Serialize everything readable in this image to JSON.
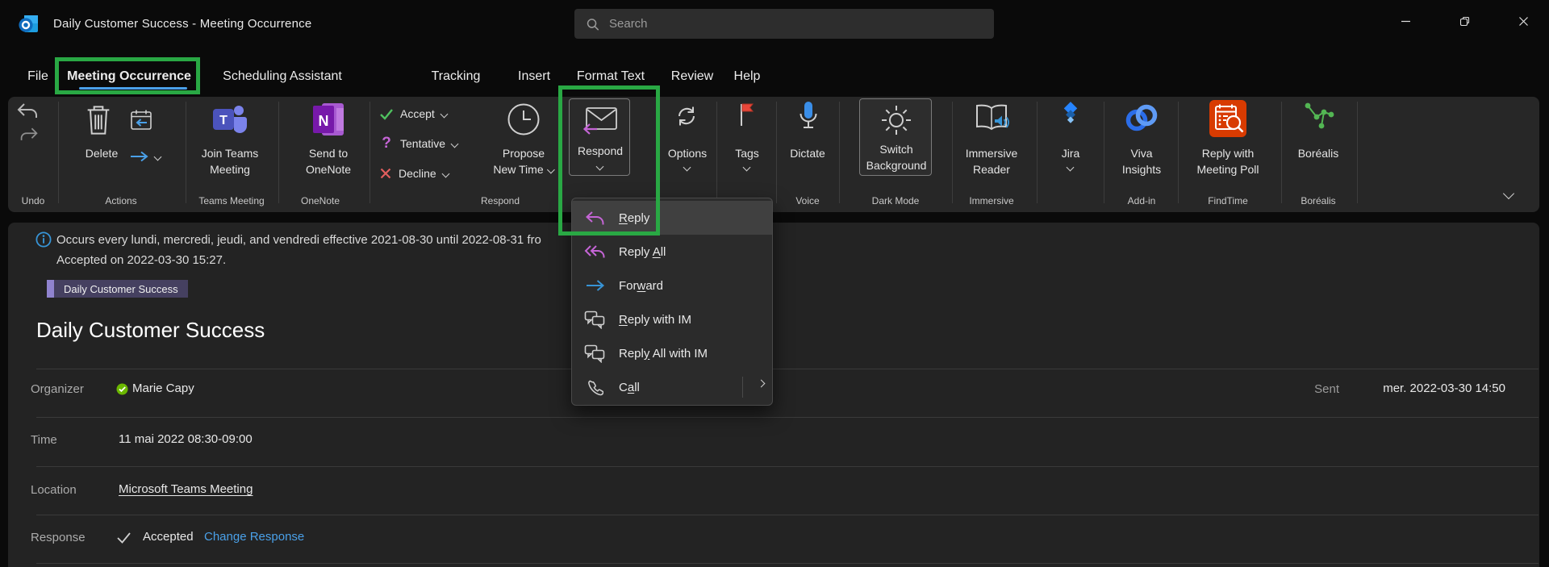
{
  "window": {
    "title": "Daily Customer Success  -  Meeting Occurrence",
    "search_placeholder": "Search"
  },
  "tabs": [
    {
      "label": "File"
    },
    {
      "label": "Meeting Occurrence",
      "active": true
    },
    {
      "label": "Scheduling Assistant"
    },
    {
      "label": "Tracking"
    },
    {
      "label": "Insert"
    },
    {
      "label": "Format Text"
    },
    {
      "label": "Review"
    },
    {
      "label": "Help"
    }
  ],
  "ribbon": {
    "delete": "Delete",
    "join_teams_1": "Join Teams",
    "join_teams_2": "Meeting",
    "send_onenote_1": "Send to",
    "send_onenote_2": "OneNote",
    "accept": "Accept",
    "tentative": "Tentative",
    "decline": "Decline",
    "propose_1": "Propose",
    "propose_2": "New Time",
    "respond": "Respond",
    "options": "Options",
    "tags": "Tags",
    "dictate": "Dictate",
    "switch_bg_1": "Switch",
    "switch_bg_2": "Background",
    "immersive_1": "Immersive",
    "immersive_2": "Reader",
    "jira": "Jira",
    "viva_1": "Viva",
    "viva_2": "Insights",
    "meeting_poll_1": "Reply with",
    "meeting_poll_2": "Meeting Poll",
    "borealis": "Boréalis",
    "group_labels": [
      "Undo",
      "Actions",
      "Teams Meeting",
      "OneNote",
      "Respond",
      "Voice",
      "Dark Mode",
      "Immersive",
      "Add-in",
      "FindTime",
      "Boréalis"
    ]
  },
  "respond_menu": {
    "items": [
      {
        "pre": "",
        "u": "R",
        "post": "eply"
      },
      {
        "pre": "Reply ",
        "u": "A",
        "post": "ll"
      },
      {
        "pre": "For",
        "u": "w",
        "post": "ard"
      },
      {
        "pre": "",
        "u": "R",
        "post": "eply with IM"
      },
      {
        "pre": "Repl",
        "u": "y",
        "post": " All with IM"
      },
      {
        "pre": "C",
        "u": "a",
        "post": "ll"
      }
    ]
  },
  "message": {
    "recurrence": "Occurs every lundi, mercredi, jeudi, and vendredi effective 2021-08-30 until 2022-08-31 fro",
    "accepted_info": "Accepted on 2022-03-30 15:27.",
    "category": "Daily Customer Success",
    "title": "Daily Customer Success",
    "organizer_label": "Organizer",
    "organizer": "Marie Capy",
    "sent_label": "Sent",
    "sent": "mer. 2022-03-30 14:50",
    "time_label": "Time",
    "time": "11 mai 2022 08:30-09:00",
    "location_label": "Location",
    "location": "Microsoft Teams Meeting",
    "response_label": "Response",
    "response_status": "Accepted",
    "response_action": "Change Response"
  },
  "colors": {
    "annotation_green": "#29a844",
    "accent_blue": "#4aa0e8",
    "reply_purple": "#c565d6",
    "accept_green": "#4fc15f",
    "decline_red": "#e25e5e",
    "findtime_orange": "#d83b01",
    "category_badge": "#454060",
    "category_accent": "#9083cf"
  }
}
